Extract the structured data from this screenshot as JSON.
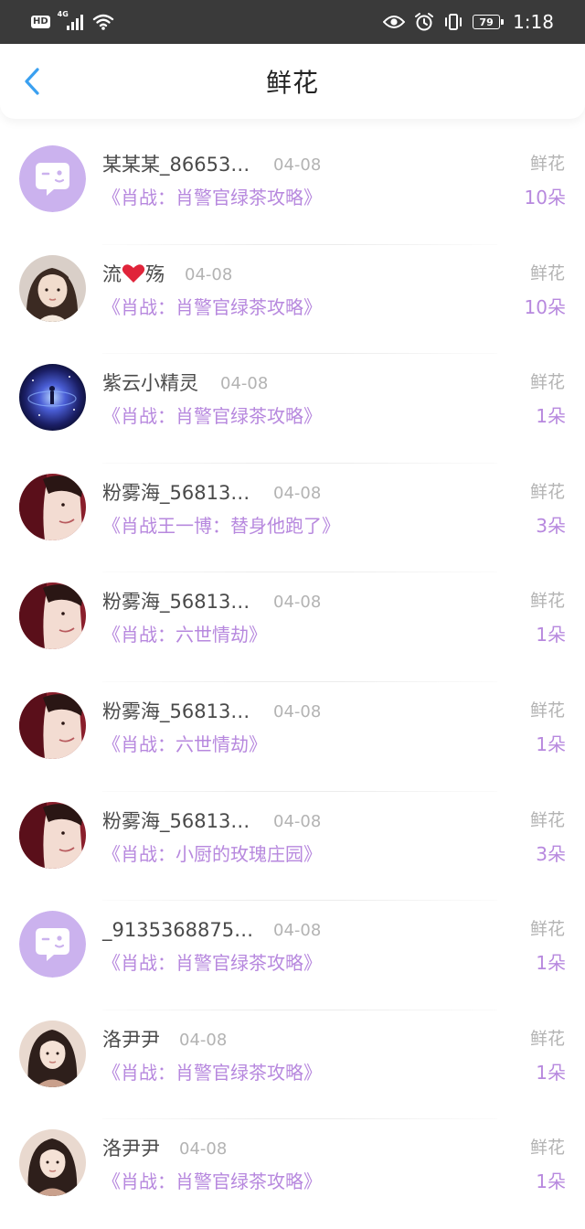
{
  "status_bar": {
    "hd": "HD",
    "network": "4G",
    "battery": "79",
    "time": "1:18"
  },
  "header": {
    "title": "鲜花"
  },
  "colors": {
    "accent": "#b788de",
    "back_arrow": "#3aa0f0",
    "muted": "#b3b3b3",
    "text": "#4a4a4a"
  },
  "rows": [
    {
      "avatar": "default-chat-avatar",
      "name": "某某某_86653…",
      "date": "04-08",
      "book": "《肖战：肖警官绿茶攻略》",
      "type": "鲜花",
      "qty": "10朵"
    },
    {
      "avatar": "girl-photo-avatar",
      "name_parts": [
        "流",
        "殇"
      ],
      "date": "04-08",
      "book": "《肖战：肖警官绿茶攻略》",
      "type": "鲜花",
      "qty": "10朵"
    },
    {
      "avatar": "galaxy-avatar",
      "name": "紫云小精灵",
      "date": "04-08",
      "book": "《肖战：肖警官绿茶攻略》",
      "type": "鲜花",
      "qty": "1朵"
    },
    {
      "avatar": "portrait-avatar",
      "name": "粉雾海_56813…",
      "date": "04-08",
      "book": "《肖战王一博：替身他跑了》",
      "type": "鲜花",
      "qty": "3朵"
    },
    {
      "avatar": "portrait-avatar",
      "name": "粉雾海_56813…",
      "date": "04-08",
      "book": "《肖战：六世情劫》",
      "type": "鲜花",
      "qty": "1朵"
    },
    {
      "avatar": "portrait-avatar",
      "name": "粉雾海_56813…",
      "date": "04-08",
      "book": "《肖战：六世情劫》",
      "type": "鲜花",
      "qty": "1朵"
    },
    {
      "avatar": "portrait-avatar",
      "name": "粉雾海_56813…",
      "date": "04-08",
      "book": "《肖战：小厨的玫瑰庄园》",
      "type": "鲜花",
      "qty": "3朵"
    },
    {
      "avatar": "default-chat-avatar",
      "name": "_9135368875…",
      "date": "04-08",
      "book": "《肖战：肖警官绿茶攻略》",
      "type": "鲜花",
      "qty": "1朵"
    },
    {
      "avatar": "long-hair-avatar",
      "name": "洛尹尹",
      "date": "04-08",
      "book": "《肖战：肖警官绿茶攻略》",
      "type": "鲜花",
      "qty": "1朵"
    },
    {
      "avatar": "long-hair-avatar",
      "name": "洛尹尹",
      "date": "04-08",
      "book": "《肖战：肖警官绿茶攻略》",
      "type": "鲜花",
      "qty": "1朵"
    }
  ]
}
